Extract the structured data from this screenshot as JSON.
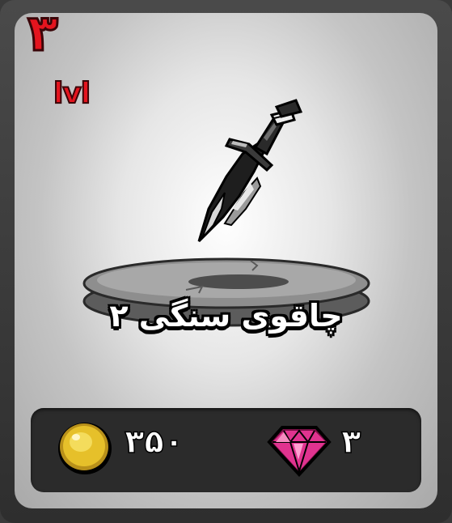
{
  "card": {
    "level_number": "۳",
    "level_label": "lvl",
    "item_name": "چاقوی سنگی ۲",
    "item_icon": "stone-knife-icon",
    "prices": {
      "coin": {
        "icon": "gold-coin-icon",
        "value": "۳۵۰"
      },
      "gem": {
        "icon": "pink-gem-icon",
        "value": "۳"
      }
    }
  },
  "colors": {
    "level_red": "#e4141e",
    "gem_pink": "#e0338f",
    "coin_gold": "#e6c02a",
    "price_bar": "#2b2b2b"
  }
}
